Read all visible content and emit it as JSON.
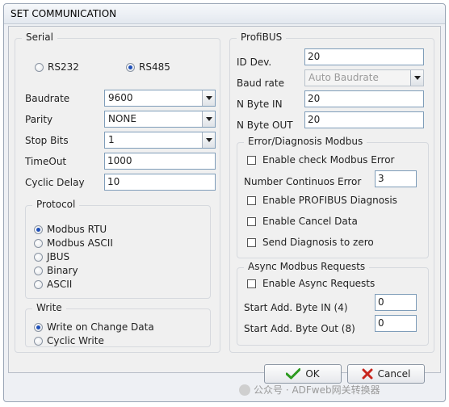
{
  "window": {
    "title": "SET COMMUNICATION"
  },
  "serial": {
    "title": "Serial",
    "interfaces": [
      {
        "label": "RS232",
        "selected": false
      },
      {
        "label": "RS485",
        "selected": true
      }
    ],
    "baudrate": {
      "label": "Baudrate",
      "value": "9600"
    },
    "parity": {
      "label": "Parity",
      "value": "NONE"
    },
    "stop_bits": {
      "label": "Stop Bits",
      "value": "1"
    },
    "timeout": {
      "label": "TimeOut",
      "value": "1000"
    },
    "cyclic_delay": {
      "label": "Cyclic Delay",
      "value": "10"
    }
  },
  "protocol": {
    "title": "Protocol",
    "options": [
      {
        "label": "Modbus RTU",
        "selected": true
      },
      {
        "label": "Modbus ASCII",
        "selected": false
      },
      {
        "label": "JBUS",
        "selected": false
      },
      {
        "label": "Binary",
        "selected": false
      },
      {
        "label": "ASCII",
        "selected": false
      }
    ]
  },
  "write": {
    "title": "Write",
    "options": [
      {
        "label": "Write on Change Data",
        "selected": true
      },
      {
        "label": "Cyclic Write",
        "selected": false
      }
    ]
  },
  "profibus": {
    "title": "ProfiBUS",
    "id_dev": {
      "label": "ID Dev.",
      "value": "20"
    },
    "baud_rate": {
      "label": "Baud rate",
      "value": "Auto Baudrate"
    },
    "n_byte_in": {
      "label": "N Byte IN",
      "value": "20"
    },
    "n_byte_out": {
      "label": "N Byte OUT",
      "value": "20"
    }
  },
  "error_diag": {
    "title": "Error/Diagnosis Modbus",
    "enable_check": {
      "label": "Enable check Modbus Error",
      "checked": false
    },
    "num_errors": {
      "label": "Number Continuos Error",
      "value": "3"
    },
    "enable_profibus_diag": {
      "label": "Enable PROFIBUS Diagnosis",
      "checked": false
    },
    "enable_cancel": {
      "label": "Enable Cancel Data",
      "checked": false
    },
    "send_diag_zero": {
      "label": "Send Diagnosis to zero",
      "checked": false
    }
  },
  "async": {
    "title": "Async Modbus Requests",
    "enable": {
      "label": "Enable Async Requests",
      "checked": false
    },
    "start_in": {
      "label": "Start Add. Byte IN (4)",
      "value": "0"
    },
    "start_out": {
      "label": "Start Add. Byte Out (8)",
      "value": "0"
    }
  },
  "buttons": {
    "ok": "OK",
    "cancel": "Cancel"
  },
  "watermark": "公众号 · ADFweb网关转换器",
  "colors": {
    "ok_check": "#2d9a20",
    "cancel_x": "#c8261e",
    "radio_selected": "#1e4fb8"
  },
  "icons": {
    "ok": "check-icon",
    "cancel": "x-icon",
    "dropdown": "chevron-down-icon"
  }
}
